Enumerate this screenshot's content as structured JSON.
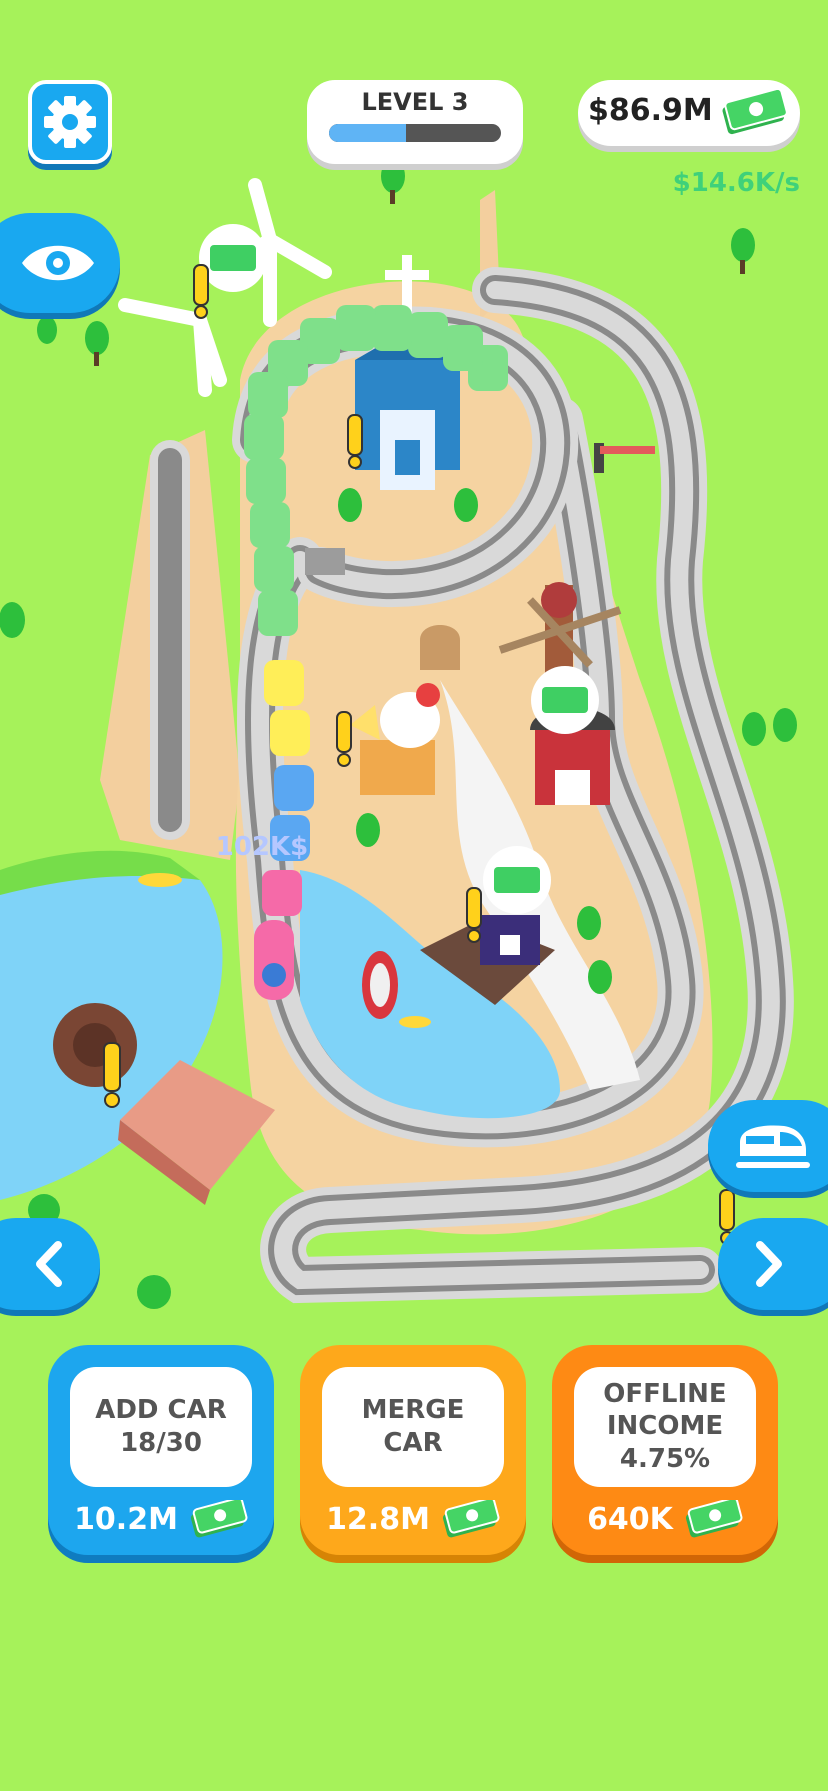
{
  "hud": {
    "level_label": "LEVEL 3",
    "level_progress": 0.45,
    "money": "$86.9M",
    "income_rate": "$14.6K/s"
  },
  "game": {
    "floating_value": "102K$"
  },
  "buttons": [
    {
      "title": "ADD CAR",
      "sub": "18/30",
      "price": "10.2M"
    },
    {
      "title": "MERGE",
      "sub": "CAR",
      "price": "12.8M"
    },
    {
      "title": "OFFLINE",
      "title2": "INCOME",
      "sub": "4.75%",
      "price": "640K"
    }
  ],
  "icons": {
    "settings": "gear-icon",
    "view": "eye-icon",
    "train": "train-icon",
    "prev": "chevron-left-icon",
    "next": "chevron-right-icon",
    "cash": "cash-icon"
  },
  "colors": {
    "grass": "#a6f25a",
    "button_blue": "#1da6ee",
    "button_orange": "#fea81b",
    "button_dark_orange": "#fe8a14",
    "income_green": "#3fd17a"
  }
}
